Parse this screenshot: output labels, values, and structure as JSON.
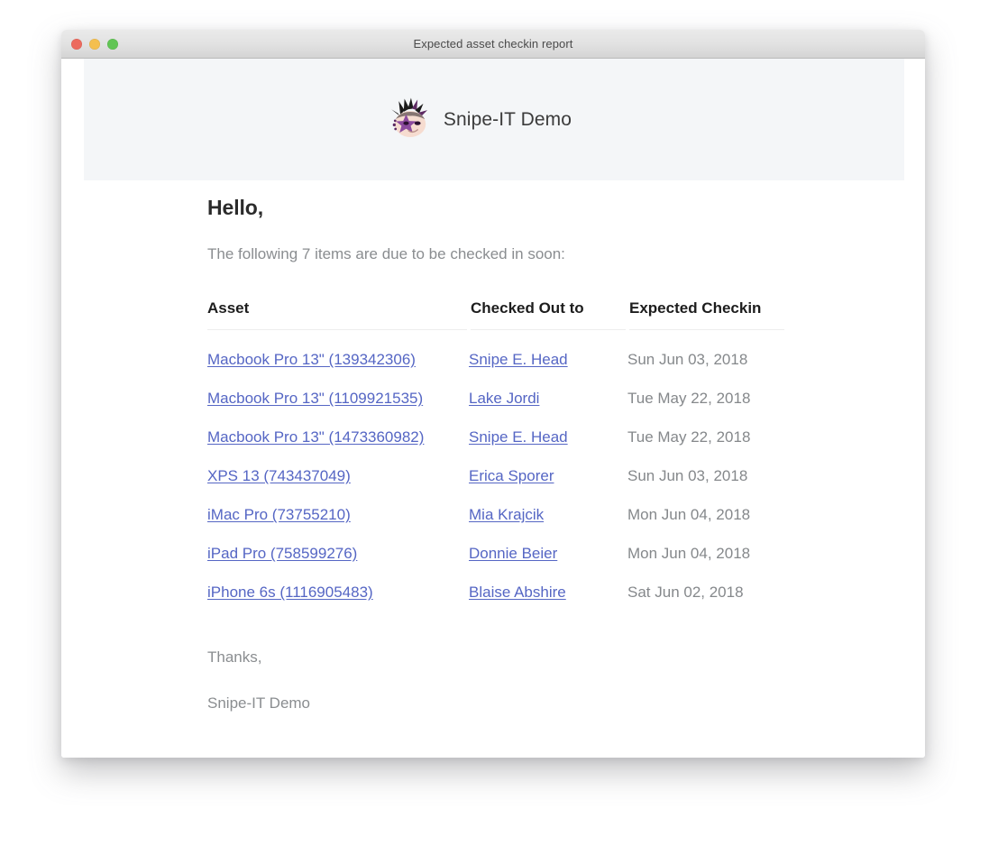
{
  "window": {
    "title": "Expected asset checkin report",
    "controls": {
      "close": "close-button",
      "minimize": "minimize-button",
      "zoom": "zoom-button"
    }
  },
  "email": {
    "brand": {
      "name": "Snipe-IT Demo",
      "logo_icon": "snipe-it-punk-logo-icon",
      "band_color": "#f4f6f8"
    },
    "greeting": "Hello,",
    "intro": "The following 7 items are due to be checked in soon:",
    "item_count": 7,
    "table": {
      "headers": [
        "Asset",
        "Checked Out to",
        "Expected Checkin"
      ],
      "rows": [
        {
          "asset": "Macbook Pro 13\" (139342306)",
          "user": "Snipe E. Head",
          "date": "Sun Jun 03, 2018"
        },
        {
          "asset": "Macbook Pro 13\" (1109921535)",
          "user": "Lake Jordi",
          "date": "Tue May 22, 2018"
        },
        {
          "asset": "Macbook Pro 13\" (1473360982)",
          "user": "Snipe E. Head",
          "date": "Tue May 22, 2018"
        },
        {
          "asset": "XPS 13 (743437049)",
          "user": "Erica Sporer",
          "date": "Sun Jun 03, 2018"
        },
        {
          "asset": "iMac Pro (73755210)",
          "user": "Mia Krajcik",
          "date": "Mon Jun 04, 2018"
        },
        {
          "asset": "iPad Pro (758599276)",
          "user": "Donnie Beier",
          "date": "Mon Jun 04, 2018"
        },
        {
          "asset": "iPhone 6s (1116905483)",
          "user": "Blaise Abshire",
          "date": "Sat Jun 02, 2018"
        }
      ]
    },
    "signoff": {
      "thanks": "Thanks,",
      "sender": "Snipe-IT Demo"
    },
    "colors": {
      "link": "#5566c4",
      "muted_text": "#8a8d90",
      "heading": "#2b2b2b",
      "rule": "#eeeeee"
    }
  }
}
